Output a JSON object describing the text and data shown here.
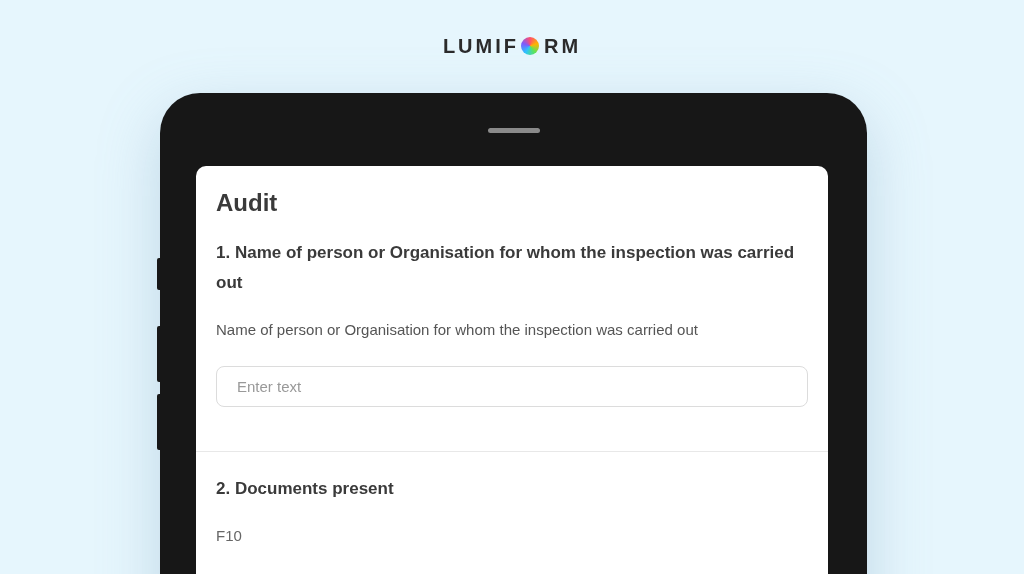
{
  "logo": {
    "text_before_icon": "LUMIF",
    "text_after_icon": "RM"
  },
  "form": {
    "title": "Audit",
    "questions": [
      {
        "kind": "text",
        "label": "1. Name of person or Organisation for whom the inspection was carried out",
        "description": "Name of person or Organisation for whom the inspection was carried out",
        "placeholder": "Enter text"
      },
      {
        "kind": "info",
        "label": "2. Documents present",
        "description": "F10"
      }
    ]
  }
}
